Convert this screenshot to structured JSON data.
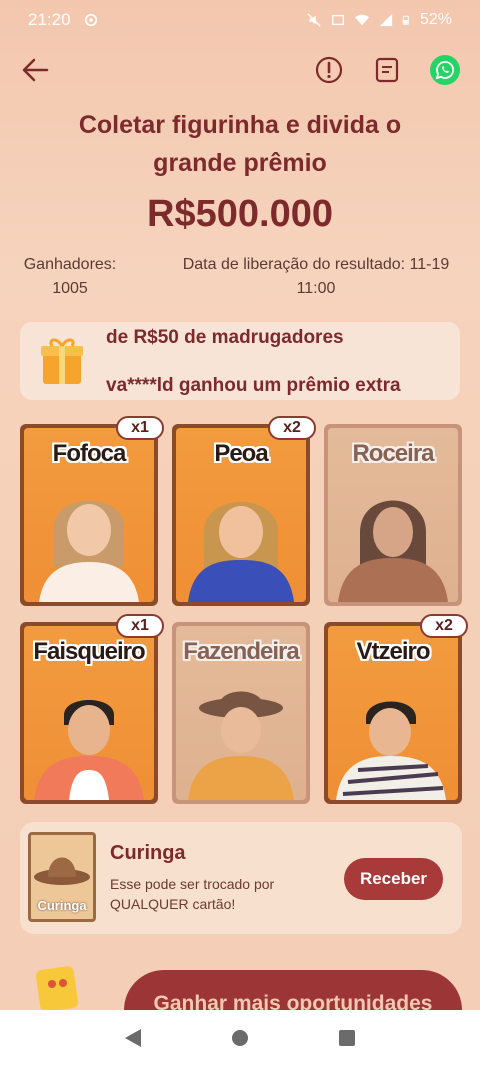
{
  "status_bar": {
    "time": "21:20",
    "battery": "52%"
  },
  "header": {
    "title": "Coletar figurinha e divida o grande prêmio",
    "prize": "R$500.000",
    "winners_label": "Ganhadores:",
    "winners_count": "1005",
    "release_label": "Data de liberação do resultado: 11-19",
    "release_time": "11:00"
  },
  "news": {
    "line1": "de R$50 de madrugadores",
    "line2": "va****ld ganhou um prêmio extra"
  },
  "cards": [
    {
      "name": "Fofoca",
      "count": "x1",
      "owned": true
    },
    {
      "name": "Peoa",
      "count": "x2",
      "owned": true
    },
    {
      "name": "Roceira",
      "count": "",
      "owned": false
    },
    {
      "name": "Faisqueiro",
      "count": "x1",
      "owned": true
    },
    {
      "name": "Fazendeira",
      "count": "",
      "owned": false
    },
    {
      "name": "Vtzeiro",
      "count": "x2",
      "owned": true
    }
  ],
  "joker": {
    "title": "Curinga",
    "image_label": "Curinga",
    "description": "Esse pode ser trocado por QUALQUER cartão!",
    "button": "Receber"
  },
  "more_button": "Ganhar mais oportunidades",
  "colors": {
    "accent": "#a83a3a",
    "title": "#7d2a2c",
    "whatsapp": "#25d366",
    "card_orange": "#f29b3f"
  }
}
